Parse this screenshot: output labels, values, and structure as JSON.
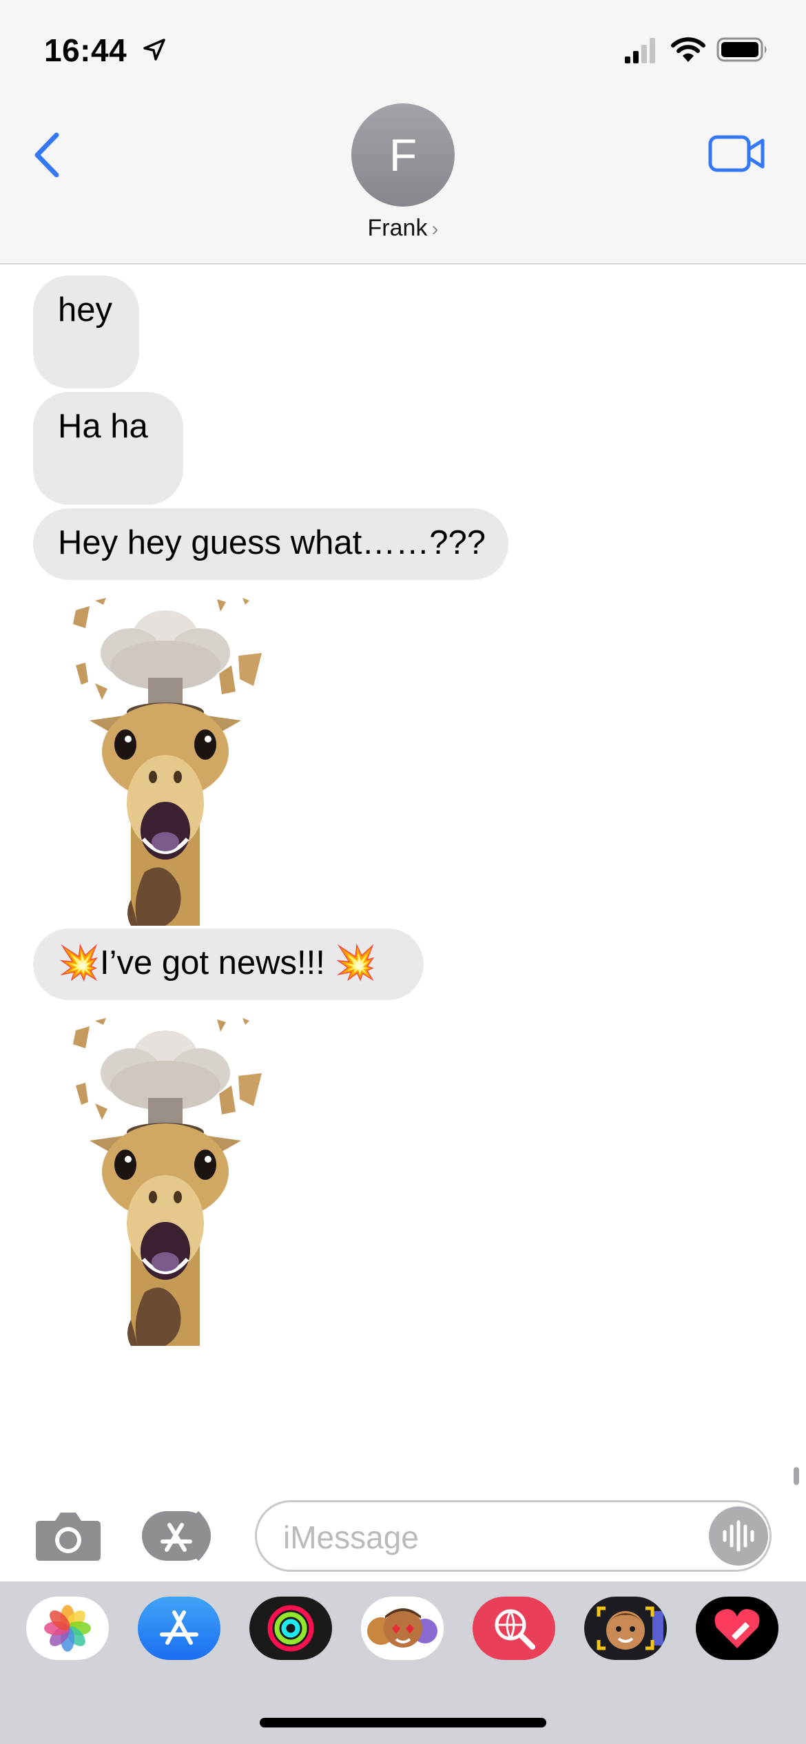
{
  "status_bar": {
    "time": "16:44"
  },
  "header": {
    "avatar_initial": "F",
    "contact_name": "Frank",
    "chevron": "›"
  },
  "messages": [
    {
      "type": "text",
      "text": "hey"
    },
    {
      "type": "text",
      "text": "Ha ha"
    },
    {
      "type": "text",
      "text": "Hey hey guess what……???"
    },
    {
      "type": "sticker",
      "icon": "giraffe-mind-blown-memoji"
    },
    {
      "type": "text",
      "text": "💥I’ve got news!!! 💥"
    },
    {
      "type": "sticker",
      "icon": "giraffe-mind-blown-memoji"
    }
  ],
  "composer": {
    "placeholder": "iMessage"
  },
  "app_drawer": [
    {
      "icon": "photos-app-icon"
    },
    {
      "icon": "app-store-icon"
    },
    {
      "icon": "activity-app-icon"
    },
    {
      "icon": "memoji-stickers-icon"
    },
    {
      "icon": "images-search-icon"
    },
    {
      "icon": "memoji-icon"
    },
    {
      "icon": "digital-touch-icon"
    }
  ],
  "colors": {
    "accent": "#3478f6",
    "bubble_received": "#e9e9eb",
    "header_bg": "#f6f6f6",
    "drawer_bg": "#d1d3d9"
  }
}
